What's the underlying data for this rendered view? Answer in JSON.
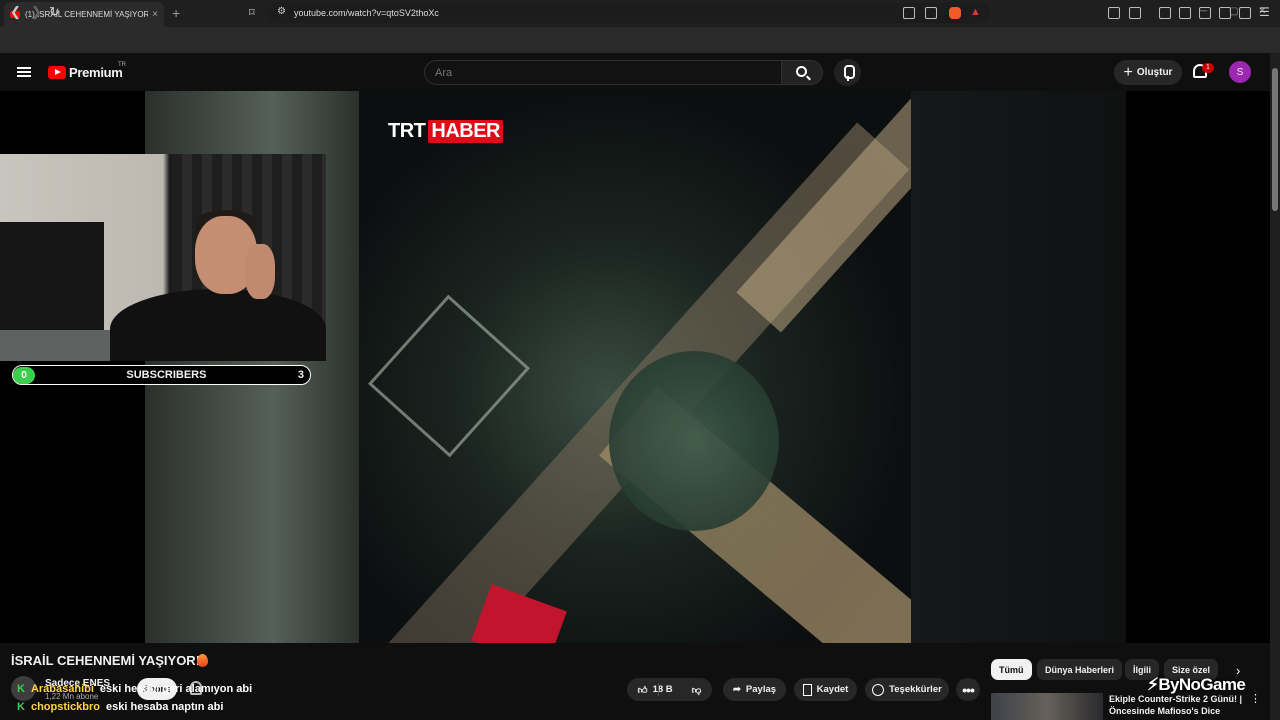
{
  "browser": {
    "tab_title": "(1) İSRAİL CEHENNEMİ YAŞIYOR!",
    "tab_close": "×",
    "new_tab": "+",
    "url": "youtube.com/watch?v=qtoSV2thoXc"
  },
  "yt": {
    "brand": "Premium",
    "brand_region": "TR",
    "search_placeholder": "Ara",
    "create_label": "Oluştur",
    "notification_count": "1",
    "avatar_letter": "S"
  },
  "video": {
    "overlay_brand_1": "TRT",
    "overlay_brand_2": "HABER",
    "title": "İSRAİL CEHENNEMİ YAŞIYOR!"
  },
  "stream_overlay": {
    "sub_left": "0",
    "sub_label": "SUBSCRIBERS",
    "sub_right": "3",
    "chat": [
      {
        "user": "Arabasahibi",
        "message": "eski hesabı geri alamıyon abi"
      },
      {
        "user": "chopstickbro",
        "message": "eski hesaba naptın abi"
      }
    ]
  },
  "channel": {
    "name": "Sadece ENES",
    "subscribers": "1,22 Mn abone",
    "subscribe_label": "Abone"
  },
  "actions": {
    "likes": "18 B",
    "share": "Paylaş",
    "save": "Kaydet",
    "thanks": "Teşekkürler",
    "more": "•••"
  },
  "chips": [
    "Tümü",
    "Dünya Haberleri",
    "İlgili",
    "Size özel"
  ],
  "recommendation": {
    "title": "Ekiple Counter-Strike 2 Günü! | Öncesinde Mafioso's Dice"
  },
  "watermark": "ByNoGame"
}
